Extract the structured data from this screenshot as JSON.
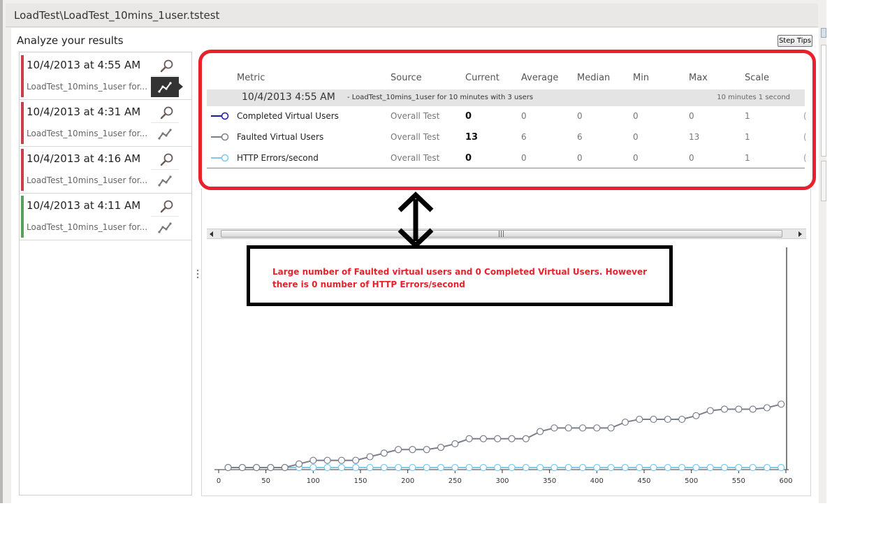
{
  "window": {
    "title": "LoadTest\\LoadTest_10mins_1user.tstest"
  },
  "header": {
    "analyze_label": "Analyze your results",
    "step_tips_label": "Step Tips"
  },
  "runs": [
    {
      "date": "10/4/2013 at 4:55 AM",
      "name": "LoadTest_10mins_1user for...",
      "status_color": "#c9404a",
      "selected": true
    },
    {
      "date": "10/4/2013 at 4:31 AM",
      "name": "LoadTest_10mins_1user for...",
      "status_color": "#c9404a",
      "selected": false
    },
    {
      "date": "10/4/2013 at 4:16 AM",
      "name": "LoadTest_10mins_1user for...",
      "status_color": "#c9404a",
      "selected": false
    },
    {
      "date": "10/4/2013 at 4:11 AM",
      "name": "LoadTest_10mins_1user for...",
      "status_color": "#5aa05a",
      "selected": false
    }
  ],
  "metrics": {
    "headers": [
      "Metric",
      "Source",
      "Current",
      "Average",
      "Median",
      "Min",
      "Max",
      "Scale"
    ],
    "group": {
      "date": "10/4/2013 4:55 AM",
      "description": "- LoadTest_10mins_1user for 10 minutes with 3 users",
      "duration": "10 minutes 1 second"
    },
    "rows": [
      {
        "name": "Completed Virtual Users",
        "source": "Overall Test",
        "current": "0",
        "average": "0",
        "median": "0",
        "min": "0",
        "max": "0",
        "scale": "1",
        "color": "#1a1aa8"
      },
      {
        "name": "Faulted Virtual Users",
        "source": "Overall Test",
        "current": "13",
        "average": "6",
        "median": "6",
        "min": "0",
        "max": "13",
        "scale": "1",
        "color": "#7a7f8a"
      },
      {
        "name": "HTTP Errors/second",
        "source": "Overall Test",
        "current": "0",
        "average": "0",
        "median": "0",
        "min": "0",
        "max": "0",
        "scale": "1",
        "color": "#7fc8ee"
      }
    ],
    "cut_glyph": "("
  },
  "annotation": {
    "text": "Large number of Faulted virtual users and 0 Completed Virtual Users. However there is 0 number of HTTP Errors/second",
    "color": "#e8212a"
  },
  "chart_data": {
    "type": "line",
    "x_ticks": [
      0,
      50,
      100,
      150,
      200,
      250,
      300,
      350,
      400,
      450,
      500,
      550,
      600
    ],
    "xlim": [
      0,
      600
    ],
    "ylim": [
      0,
      13
    ],
    "series": [
      {
        "name": "Faulted Virtual Users",
        "color": "#7a7f8a",
        "x": [
          10,
          25,
          40,
          55,
          70,
          85,
          100,
          115,
          130,
          145,
          160,
          175,
          190,
          205,
          220,
          235,
          250,
          265,
          280,
          295,
          310,
          325,
          340,
          355,
          370,
          385,
          400,
          415,
          430,
          445,
          460,
          475,
          490,
          505,
          520,
          535,
          550,
          565,
          580,
          595
        ],
        "values": [
          0,
          0,
          0,
          0,
          0,
          0.5,
          1,
          1,
          1,
          1,
          1.5,
          2,
          2.5,
          2.5,
          2.5,
          2.8,
          3.3,
          4,
          4,
          4,
          4,
          4,
          5,
          5.5,
          5.5,
          5.5,
          5.5,
          5.5,
          6.3,
          6.7,
          6.7,
          6.7,
          6.7,
          7.2,
          7.9,
          8.1,
          8.1,
          8.1,
          8.3,
          8.8
        ]
      },
      {
        "name": "HTTP Errors/second",
        "color": "#7fc8ee",
        "x": [
          10,
          25,
          40,
          55,
          70,
          85,
          100,
          115,
          130,
          145,
          160,
          175,
          190,
          205,
          220,
          235,
          250,
          265,
          280,
          295,
          310,
          325,
          340,
          355,
          370,
          385,
          400,
          415,
          430,
          445,
          460,
          475,
          490,
          505,
          520,
          535,
          550,
          565,
          580,
          595
        ],
        "values": [
          0,
          0,
          0,
          0,
          0,
          0,
          0,
          0,
          0,
          0,
          0,
          0,
          0,
          0,
          0,
          0,
          0,
          0,
          0,
          0,
          0,
          0,
          0,
          0,
          0,
          0,
          0,
          0,
          0,
          0,
          0,
          0,
          0,
          0,
          0,
          0,
          0,
          0,
          0,
          0
        ]
      }
    ]
  }
}
